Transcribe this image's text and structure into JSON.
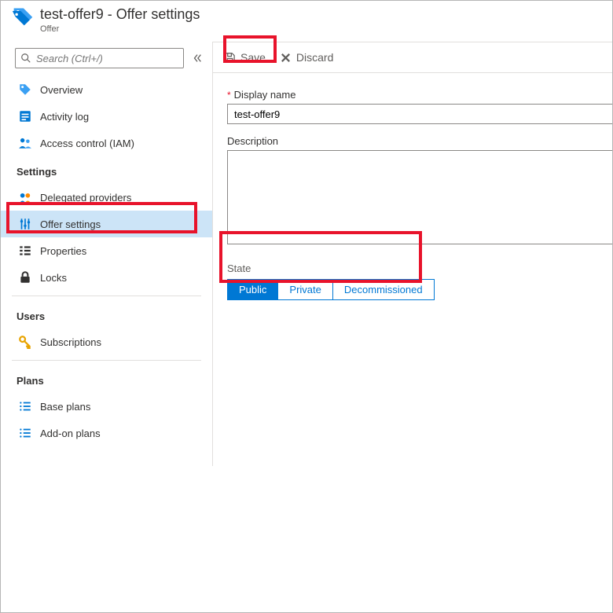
{
  "header": {
    "title": "test-offer9 - Offer settings",
    "subtitle": "Offer"
  },
  "search": {
    "placeholder": "Search (Ctrl+/)"
  },
  "nav": {
    "top": [
      {
        "label": "Overview"
      },
      {
        "label": "Activity log"
      },
      {
        "label": "Access control (IAM)"
      }
    ],
    "settings_title": "Settings",
    "settings": [
      {
        "label": "Delegated providers"
      },
      {
        "label": "Offer settings"
      },
      {
        "label": "Properties"
      },
      {
        "label": "Locks"
      }
    ],
    "users_title": "Users",
    "users": [
      {
        "label": "Subscriptions"
      }
    ],
    "plans_title": "Plans",
    "plans": [
      {
        "label": "Base plans"
      },
      {
        "label": "Add-on plans"
      }
    ]
  },
  "toolbar": {
    "save": "Save",
    "discard": "Discard"
  },
  "form": {
    "display_name_label": "Display name",
    "display_name_value": "test-offer9",
    "description_label": "Description",
    "description_value": "",
    "state_label": "State",
    "state_options": {
      "public": "Public",
      "private": "Private",
      "decom": "Decommissioned"
    }
  }
}
